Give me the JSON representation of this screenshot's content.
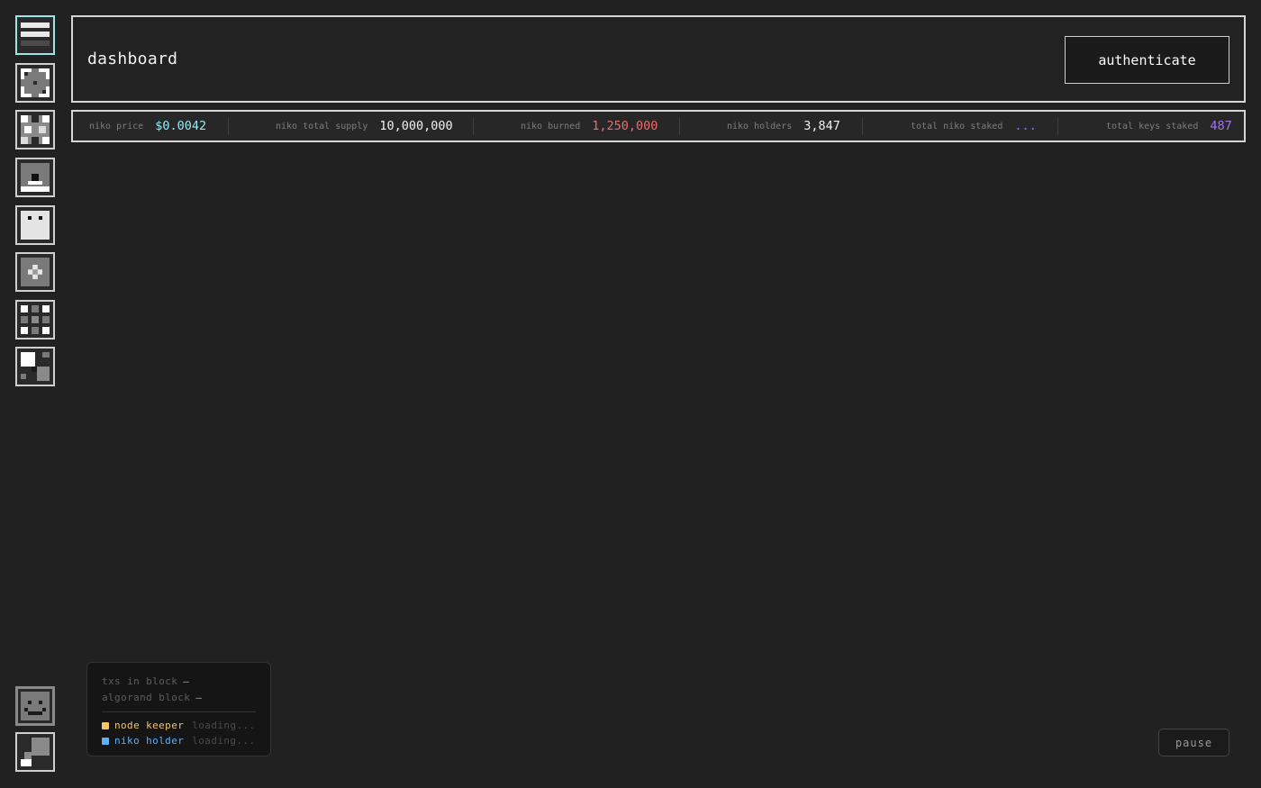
{
  "sidebar": {
    "items": [
      {
        "icon": "menu-icon"
      },
      {
        "icon": "frame-pixel-icon"
      },
      {
        "icon": "checker-pixel-icon"
      },
      {
        "icon": "face-pixel-icon"
      },
      {
        "icon": "ghost-pixel-icon"
      },
      {
        "icon": "plus-pixel-icon"
      },
      {
        "icon": "ring-pixel-icon"
      },
      {
        "icon": "block-pixel-icon"
      }
    ],
    "footer": [
      {
        "icon": "smiley-pixel-icon"
      },
      {
        "icon": "corner-pixel-icon"
      }
    ]
  },
  "header": {
    "title": "dashboard",
    "auth_label": "authenticate"
  },
  "stats": [
    {
      "label": "niko price",
      "value": "$0.0042",
      "color": "#9ae8f0"
    },
    {
      "label": "niko total supply",
      "value": "10,000,000",
      "color": "#f1f1f1"
    },
    {
      "label": "niko burned",
      "value": "1,250,000",
      "color": "#ef6b6b"
    },
    {
      "label": "niko holders",
      "value": "3,847",
      "color": "#f1f1f1"
    },
    {
      "label": "total niko staked",
      "value": "...",
      "color": "#6f7cff"
    },
    {
      "label": "total keys staked",
      "value": "487",
      "color": "#a275f5"
    }
  ],
  "status": {
    "txs_label": "txs in block",
    "txs_value": "—",
    "block_label": "algorand block",
    "block_value": "—",
    "roles": [
      {
        "name": "node keeper",
        "status": "loading...",
        "color": "#f3c46b"
      },
      {
        "name": "niko holder",
        "status": "loading...",
        "color": "#5fb0f5"
      }
    ]
  },
  "controls": {
    "pause_label": "pause"
  }
}
